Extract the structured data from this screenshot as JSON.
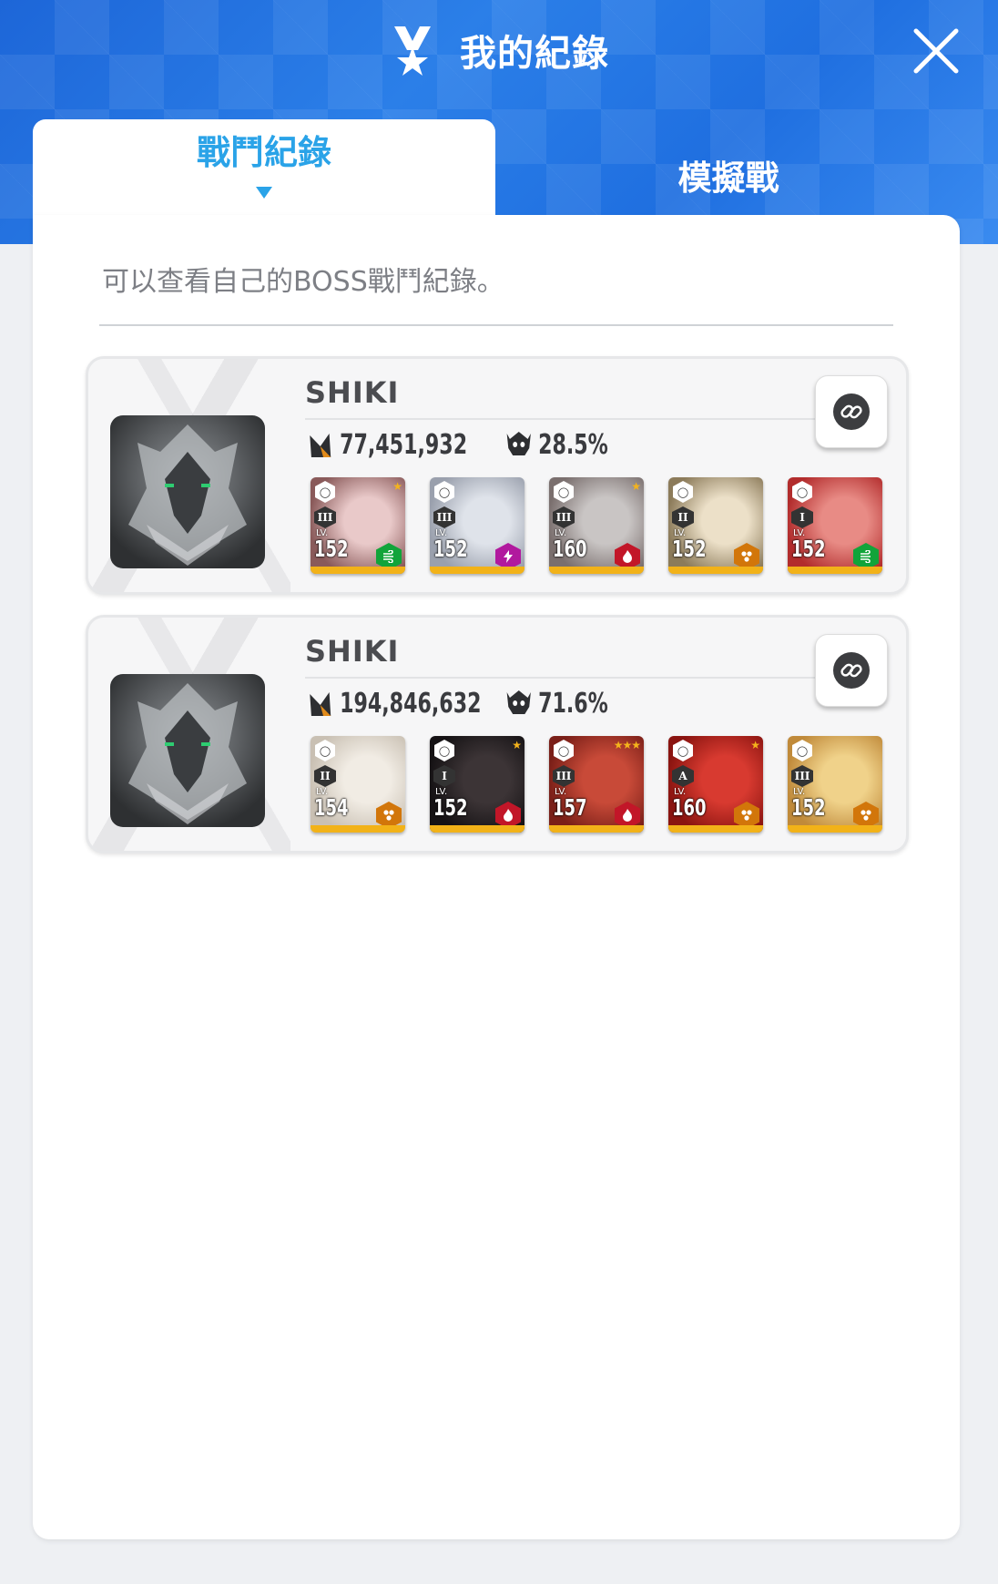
{
  "header": {
    "title": "我的紀錄",
    "icon": "medal-star-icon"
  },
  "tabs": [
    {
      "label": "戰鬥紀錄",
      "active": true
    },
    {
      "label": "模擬戰",
      "active": false
    }
  ],
  "description": "可以查看自己的BOSS戰鬥紀錄。",
  "records": [
    {
      "name": "SHIKI",
      "damage": "77,451,932",
      "percent": "28.5%",
      "characters": [
        {
          "burst": "III",
          "level": "152",
          "element": "wind",
          "stars": 1
        },
        {
          "burst": "III",
          "level": "152",
          "element": "electric",
          "stars": 0
        },
        {
          "burst": "III",
          "level": "160",
          "element": "fire",
          "stars": 1
        },
        {
          "burst": "II",
          "level": "152",
          "element": "iron",
          "stars": 0
        },
        {
          "burst": "I",
          "level": "152",
          "element": "wind",
          "stars": 0
        }
      ]
    },
    {
      "name": "SHIKI",
      "damage": "194,846,632",
      "percent": "71.6%",
      "characters": [
        {
          "burst": "II",
          "level": "154",
          "element": "iron",
          "stars": 0
        },
        {
          "burst": "I",
          "level": "152",
          "element": "fire",
          "stars": 1
        },
        {
          "burst": "III",
          "level": "157",
          "element": "fire",
          "stars": 3
        },
        {
          "burst": "A",
          "level": "160",
          "element": "iron",
          "stars": 1
        },
        {
          "burst": "III",
          "level": "152",
          "element": "iron",
          "stars": 0
        }
      ]
    }
  ],
  "lv_label": "LV.",
  "colors": {
    "header_blue": "#1f6fe0",
    "tab_active_text": "#2aa3e8",
    "wind": "#11a43a",
    "electric": "#b1199e",
    "fire": "#c21628",
    "iron": "#d2760a"
  }
}
